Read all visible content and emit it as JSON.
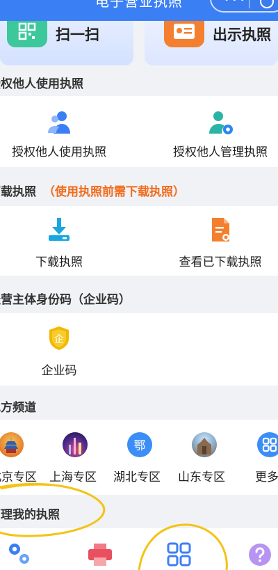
{
  "header": {
    "title": "电子营业执照"
  },
  "quick_actions": [
    {
      "label": "扫一扫"
    },
    {
      "label": "出示执照"
    }
  ],
  "sections": {
    "authorize": {
      "title": "授权他人使用执照",
      "items": [
        {
          "label": "授权他人使用执照",
          "icon": "users-icon"
        },
        {
          "label": "授权他人管理执照",
          "icon": "user-gear-icon"
        }
      ]
    },
    "download": {
      "title": "下载执照",
      "note": "（使用执照前需下载执照）",
      "items": [
        {
          "label": "下载执照",
          "icon": "download-icon"
        },
        {
          "label": "查看已下载执照",
          "icon": "document-icon"
        }
      ]
    },
    "enterprise_code": {
      "title": "经营主体身份码（企业码）",
      "items": [
        {
          "label": "企业码",
          "icon": "enterprise-shield-icon",
          "glyph": "企"
        }
      ]
    },
    "local": {
      "title": "地方频道",
      "items": [
        {
          "label": "北京专区",
          "icon": "beijing-icon"
        },
        {
          "label": "上海专区",
          "icon": "shanghai-icon"
        },
        {
          "label": "湖北专区",
          "icon": "hubei-icon",
          "glyph": "鄂"
        },
        {
          "label": "山东专区",
          "icon": "shandong-icon"
        },
        {
          "label": "更多",
          "icon": "more-grid-icon"
        }
      ]
    },
    "manage": {
      "title": "管理我的执照"
    }
  },
  "colors": {
    "primary": "#3b7ff5",
    "accent_orange": "#f26a1b",
    "annotation": "#f3c315"
  }
}
